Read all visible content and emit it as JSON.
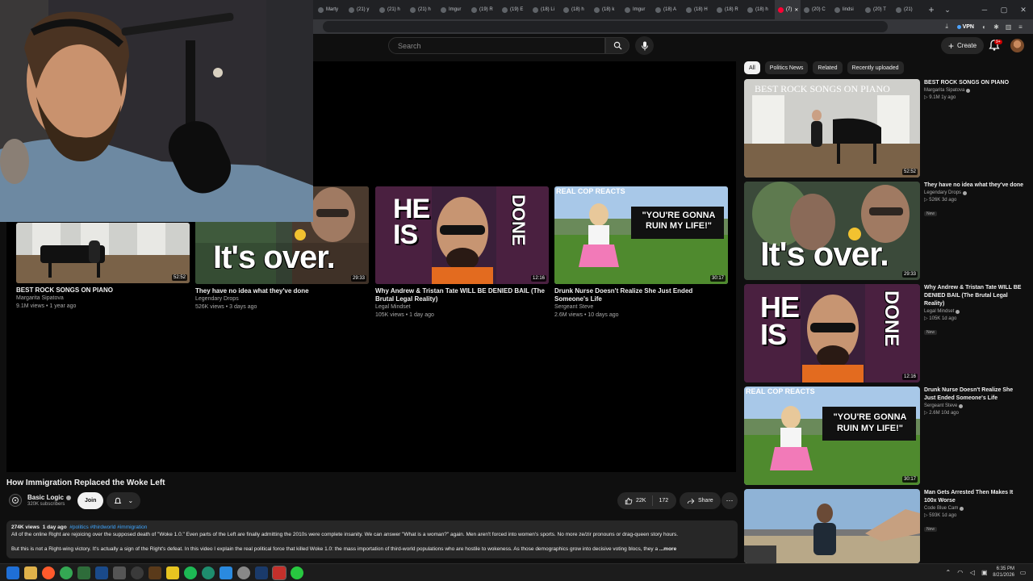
{
  "browser": {
    "tabs": [
      {
        "label": "Marty"
      },
      {
        "label": "(21) y"
      },
      {
        "label": "(21) h"
      },
      {
        "label": "(21) h"
      },
      {
        "label": "Imgur"
      },
      {
        "label": "(19) R"
      },
      {
        "label": "(19) E"
      },
      {
        "label": "(18) Li"
      },
      {
        "label": "(18) h"
      },
      {
        "label": "(18) k"
      },
      {
        "label": "Imgur"
      },
      {
        "label": "(18) A"
      },
      {
        "label": "(18) H"
      },
      {
        "label": "(18) R"
      },
      {
        "label": "(18) h"
      },
      {
        "label": "(7)",
        "active": true
      },
      {
        "label": "(20) C"
      },
      {
        "label": "lindsi"
      },
      {
        "label": "(20) T"
      },
      {
        "label": "(21)"
      }
    ],
    "vpn_label": "VPN"
  },
  "header": {
    "search_placeholder": "Search",
    "create_label": "Create",
    "notif_badge": "9+"
  },
  "end_screen": [
    {
      "title": "BEST ROCK SONGS ON PIANO",
      "channel": "Margarita Sipatova",
      "meta": "9.1M views • 1 year ago",
      "duration": "52:52"
    },
    {
      "title": "They have no idea what they've done",
      "channel": "Legendary Drops",
      "meta": "526K views • 3 days ago",
      "duration": "29:33"
    },
    {
      "title": "Why Andrew & Tristan Tate WILL BE DENIED BAIL (The Brutal Legal Reality)",
      "channel": "Legal Mindset",
      "meta": "105K views • 1 day ago",
      "duration": "12:16"
    },
    {
      "title": "Drunk Nurse Doesn't Realize She Just Ended Someone's Life",
      "channel": "Sergeant Steve",
      "meta": "2.6M views • 10 days ago",
      "duration": "30:17"
    }
  ],
  "thumb_text": {
    "piano": "BEST ROCK SONGS ON PIANO",
    "over": "It's over.",
    "he": "HE",
    "is": "IS",
    "done": "DONE",
    "cop": "REAL COP REACTS",
    "ruin": "\"YOU'RE GONNA RUIN MY LIFE!\""
  },
  "video": {
    "title": "How Immigration Replaced the Woke Left",
    "channel": "Basic Logic",
    "subscribers": "320K subscribers",
    "join_label": "Join",
    "likes": "22K",
    "dislikes": "172",
    "share_label": "Share",
    "views": "274K views",
    "age": "1 day ago",
    "tags": "#politics #thirdworld #immigration",
    "desc_line1": "All of the online Right are rejoicing over the supposed death of \"Woke 1.0.\" Even parts of the Left are finally admitting the 2010s were complete insanity. We can answer \"What is a woman?\" again. Men aren't forced into women's sports. No more ze/zir pronouns or drag-queen story hours.",
    "desc_line2": "But this is not a Right-wing victory. It's actually a sign of the Right's defeat.  In this video I explain the real political force that killed Woke 1.0: the mass importation of third-world populations who are hostile to wokeness. As those demographics grow into decisive voting blocs, they a",
    "more_label": "...more"
  },
  "sidebar": {
    "chips": [
      "All",
      "Politics News",
      "Related",
      "Recently uploaded"
    ],
    "items": [
      {
        "title": "BEST ROCK SONGS ON PIANO",
        "channel": "Margarita Sipatova",
        "meta": "▷ 9.1M  1y ago",
        "duration": "52:52",
        "new": ""
      },
      {
        "title": "They have no idea what they've done",
        "channel": "Legendary Drops",
        "meta": "▷ 526K  3d ago",
        "duration": "29:33",
        "new": "New"
      },
      {
        "title": "Why Andrew & Tristan Tate WILL BE DENIED BAIL (The Brutal Legal Reality)",
        "channel": "Legal Mindset",
        "meta": "▷ 105K  1d ago",
        "duration": "12:16",
        "new": "New"
      },
      {
        "title": "Drunk Nurse Doesn't Realize She Just Ended Someone's Life",
        "channel": "Sergeant Steve",
        "meta": "▷ 2.6M  10d ago",
        "duration": "30:17",
        "new": ""
      },
      {
        "title": "Man Gets Arrested Then Makes It 100x Worse",
        "channel": "Code Blue Cam",
        "meta": "▷ 593K  1d ago",
        "duration": "",
        "new": "New"
      }
    ]
  },
  "taskbar": {
    "time": "6:35 PM",
    "date": "8/21/2026"
  }
}
